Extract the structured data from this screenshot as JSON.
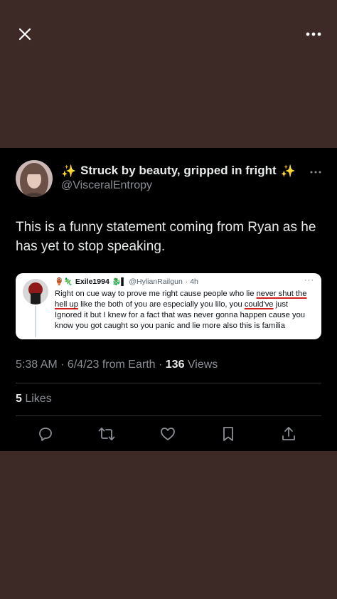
{
  "viewer": {
    "close_icon": "close-icon",
    "more_icon": "more-horizontal-icon"
  },
  "tweet": {
    "display_name": "Struck by beauty, gripped in fright",
    "name_emoji_left": "✨",
    "name_emoji_right": "✨",
    "handle": "@VisceralEntropy",
    "more_icon": "more-horizontal-icon",
    "text": "This is a funny statement coming from Ryan as he has yet to stop speaking.",
    "embedded": {
      "username": "Exile1994",
      "user_emojis": "🏺🦎",
      "handle_emojis": "🐉▌",
      "handle": "@HylianRailgun",
      "time": "· 4h",
      "more": "···",
      "body_1": "Right on cue way to prove me right cause people who lie ",
      "body_ul_1": "never shut the hell up",
      "body_2": " like the both of you are especially you lilo, you ",
      "body_ul_2": "could've",
      "body_3": " just Ignored it but I knew for a fact that was never gonna happen cause you know you got caught so you panic and lie more also this is familia"
    },
    "timestamp": "5:38 AM · 6/4/23 from Earth · ",
    "views_count": "136",
    "views_label": " Views",
    "likes_count": "5",
    "likes_label": " Likes",
    "actions": [
      "reply-icon",
      "retweet-icon",
      "like-icon",
      "bookmark-icon",
      "share-icon"
    ]
  },
  "colors": {
    "backdrop": "#3d2a26",
    "tweet_bg": "#000000",
    "text_primary": "#e7e9ea",
    "text_secondary": "#8b8f95",
    "underline_red": "#d0201c"
  }
}
